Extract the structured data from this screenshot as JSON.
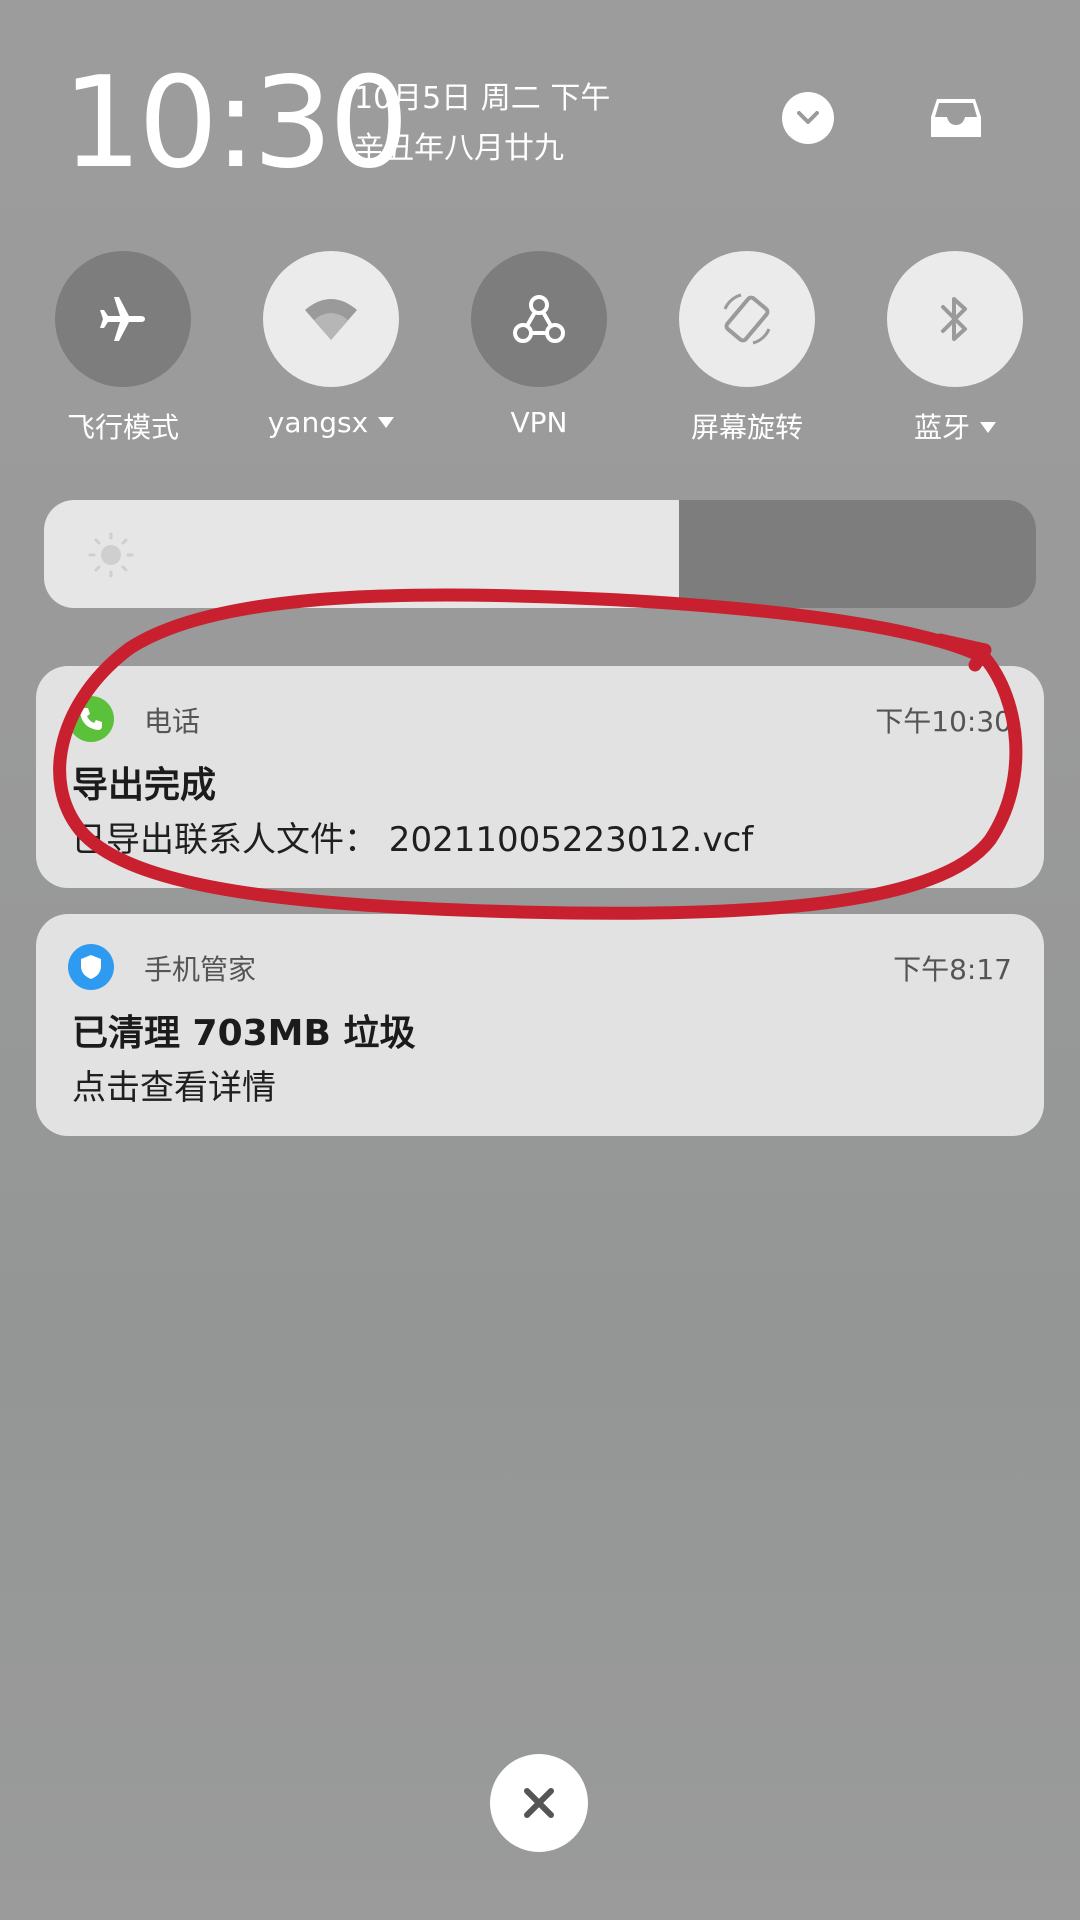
{
  "header": {
    "time": "10:30",
    "date_line": "10月5日 周二 下午",
    "lunar_line": "辛丑年八月廿九",
    "expand_icon": "chevron-down-icon",
    "inbox_icon": "inbox-tray-icon"
  },
  "toggles": [
    {
      "label": "飞行模式",
      "icon": "airplane-icon",
      "active": false,
      "has_dropdown": false
    },
    {
      "label": "yangsx",
      "icon": "wifi-icon",
      "active": true,
      "has_dropdown": true
    },
    {
      "label": "VPN",
      "icon": "vpn-icon",
      "active": false,
      "has_dropdown": false
    },
    {
      "label": "屏幕旋转",
      "icon": "screen-rotation-icon",
      "active": true,
      "has_dropdown": false
    },
    {
      "label": "蓝牙",
      "icon": "bluetooth-icon",
      "active": true,
      "has_dropdown": true
    }
  ],
  "brightness": {
    "level": 0.64,
    "icon": "brightness-icon"
  },
  "notifications": [
    {
      "app": "电话",
      "icon": "phone-icon",
      "time": "下午10:30",
      "title": "导出完成",
      "body": "已导出联系人文件：  20211005223012.vcf",
      "highlighted": true
    },
    {
      "app": "手机管家",
      "icon": "shield-icon",
      "time": "下午8:17",
      "title": "已清理 703MB 垃圾",
      "body": "点击查看详情",
      "highlighted": false
    }
  ],
  "close_button": {
    "icon": "close-icon"
  },
  "colors": {
    "toggle_on": "#ebebeb",
    "toggle_off": "#7d7d7d",
    "phone_app": "#5cc13a",
    "guard_app": "#2e9bf0",
    "annotation": "#c8202e"
  }
}
